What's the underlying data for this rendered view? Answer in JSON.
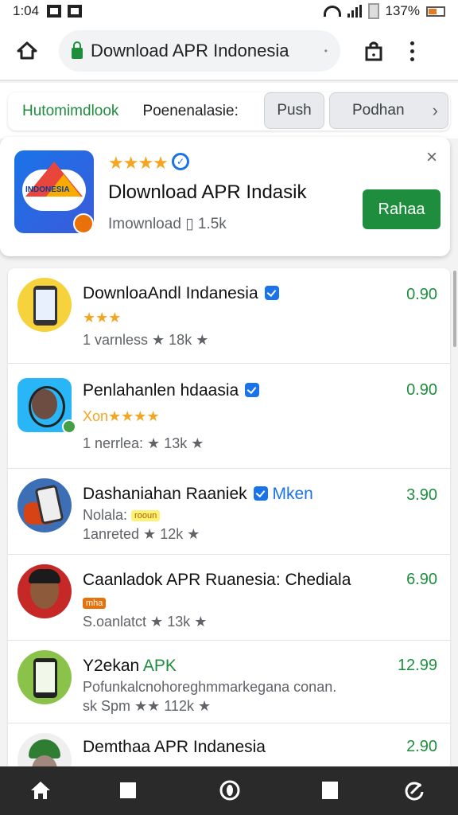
{
  "status_bar": {
    "time": "1:04",
    "battery": "137%"
  },
  "browser": {
    "url_text": "Download APR Indonesia",
    "home_icon": "home-icon",
    "tabs_icon": "tabs-icon",
    "menu_icon": "more-vert-icon"
  },
  "filters": {
    "active": "Hutomimdlook",
    "second": "Poenenalasie:",
    "push_label": "Push",
    "podhan_label": "Podhan",
    "chevron": "›"
  },
  "featured": {
    "stars": "★★★★",
    "title": "Dlownload APR Indasik",
    "subtitle": "Imownload  ▯ 1.5k",
    "install_label": "Rahaa",
    "close": "×",
    "logo_text": "INDONESIA"
  },
  "apps": [
    {
      "title": "DownloaAndl Indanesia",
      "stars": "★★★",
      "meta": "1 varnless ★  18k  ★",
      "price": "0.90"
    },
    {
      "title": "Penlahanlen hdaasia",
      "stars_prefix": "Xon",
      "stars": "★★★★",
      "meta": "1 nerrlea:  ★  13k  ★",
      "price": "0.90"
    },
    {
      "title": "Dashaniahan Raaniek",
      "title_suffix": "Mken",
      "meta_top": "Nolala:",
      "badge": "rooun",
      "meta": "1anreted  ★  12k  ★",
      "price": "3.90"
    },
    {
      "title": "Caanladok APR Ruanesia: Chediala",
      "badge": "mha",
      "meta": "S.oanlatct  ★  13k  ★",
      "price": "6.90"
    },
    {
      "title": "Y2ekan",
      "title_green": "APK",
      "desc": "Pofunkalcnohoreghmmarkegana conan.",
      "meta": "sk Spm ★★ 112k  ★",
      "price": "12.99"
    },
    {
      "title": "Demthaa APR Indanesia",
      "price": "2.90"
    }
  ],
  "bottom_nav": [
    "home-icon",
    "square-icon",
    "circle-icon",
    "square-icon",
    "refresh-icon"
  ]
}
